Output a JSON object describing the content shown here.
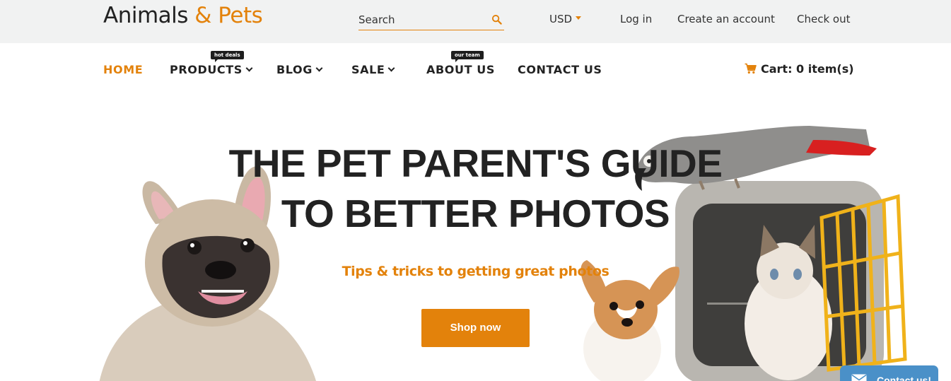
{
  "header": {
    "logo_part1": "Animals ",
    "logo_part2": "& Pets",
    "search_placeholder": "Search",
    "currency": "USD",
    "links": {
      "login": "Log in",
      "create_account": "Create an account",
      "checkout": "Check out"
    }
  },
  "nav": {
    "items": [
      {
        "label": "HOME"
      },
      {
        "label": "PRODUCTS",
        "badge": "hot deals"
      },
      {
        "label": "BLOG"
      },
      {
        "label": "SALE"
      },
      {
        "label": "ABOUT US",
        "badge": "our team"
      },
      {
        "label": "CONTACT US"
      }
    ],
    "cart_label": "Cart: 0 item(s)"
  },
  "hero": {
    "title_line1": "THE PET PARENT'S GUIDE",
    "title_line2": "TO BETTER PHOTOS",
    "subtitle": "Tips & tricks to getting great photos",
    "button": "Shop now"
  },
  "widget": {
    "contact_label": "Contact us!"
  },
  "colors": {
    "accent": "#e3820b",
    "topbar_bg": "#f1f2f2",
    "text": "#222222",
    "widget_bg": "#4a90c8"
  },
  "icons": {
    "search": "search-icon",
    "cart": "cart-icon",
    "dropdown": "chevron-down-icon",
    "caret": "caret-down-icon",
    "contact": "envelope-icon"
  }
}
